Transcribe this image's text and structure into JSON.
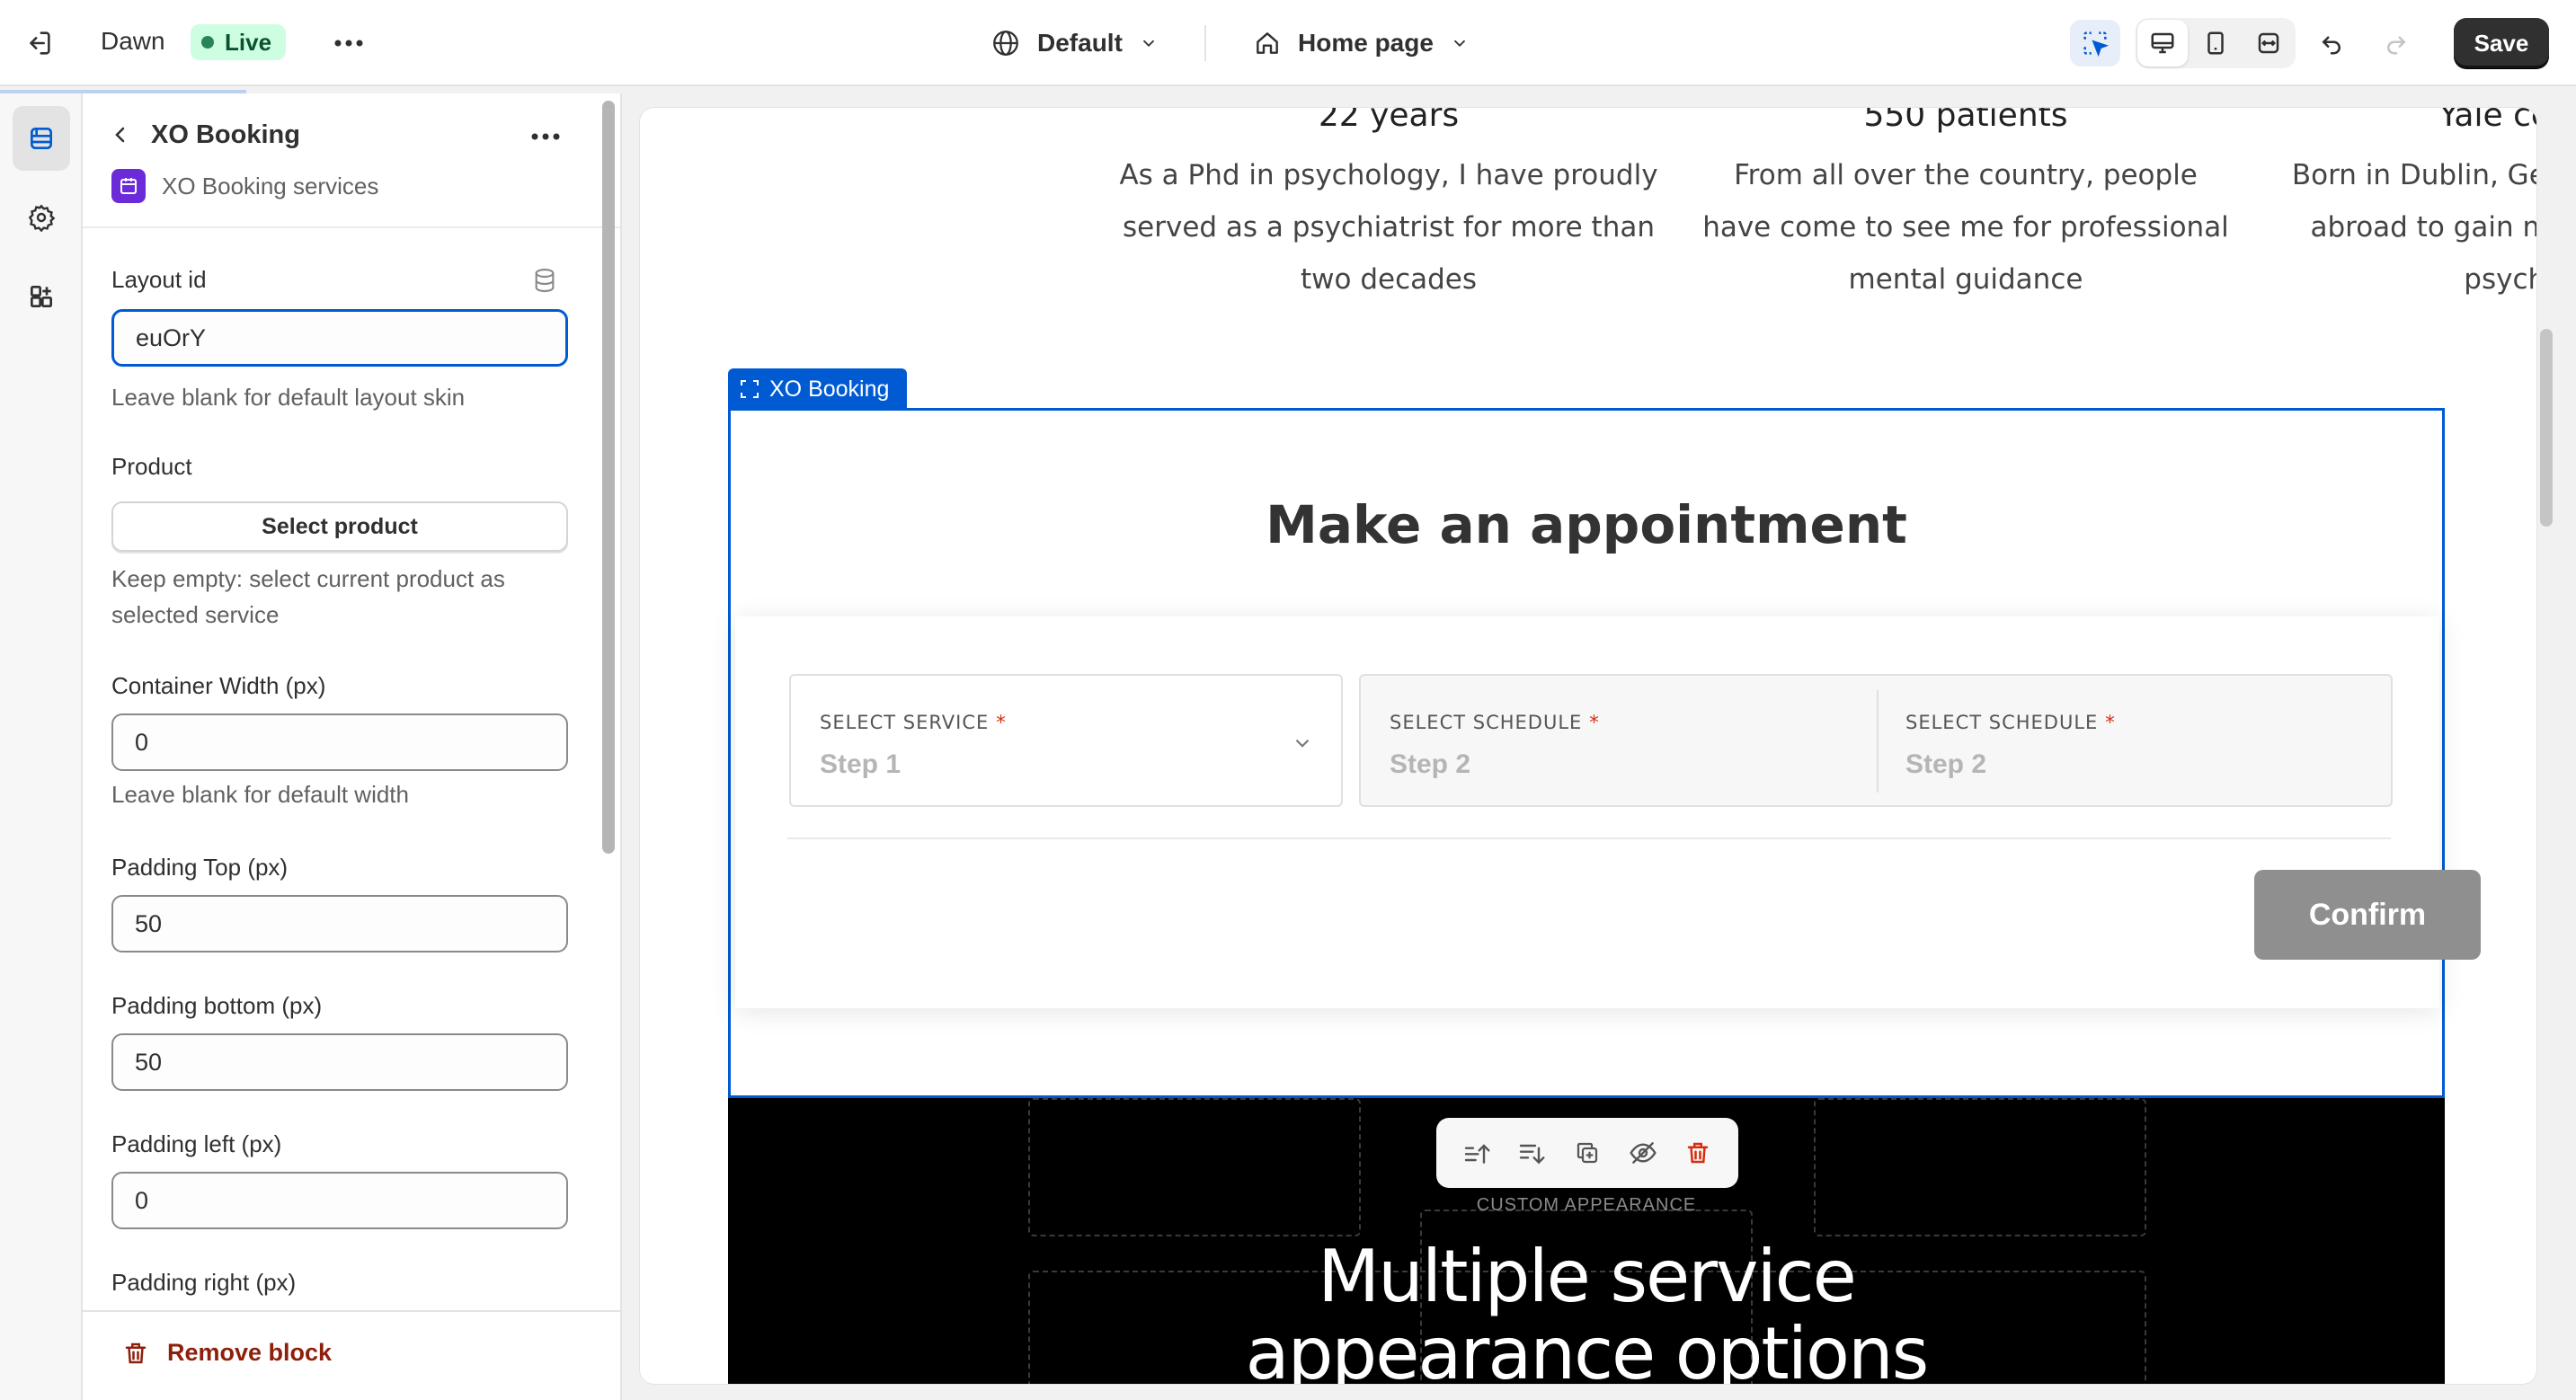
{
  "topbar": {
    "theme_name": "Dawn",
    "status_badge": "Live",
    "template_selector": "Default",
    "page_selector": "Home page",
    "save_label": "Save"
  },
  "sidebar": {
    "block_title": "XO Booking",
    "app_name": "XO Booking services",
    "layout_id": {
      "label": "Layout id",
      "value": "euOrY",
      "help": "Leave blank for default layout skin"
    },
    "product": {
      "label": "Product",
      "button": "Select product",
      "help": "Keep empty: select current product as selected service"
    },
    "container_width": {
      "label": "Container Width (px)",
      "value": "0",
      "help": "Leave blank for default width"
    },
    "padding_top": {
      "label": "Padding Top (px)",
      "value": "50"
    },
    "padding_bottom": {
      "label": "Padding bottom (px)",
      "value": "50"
    },
    "padding_left": {
      "label": "Padding left (px)",
      "value": "0"
    },
    "padding_right": {
      "label": "Padding right (px)"
    },
    "remove_block": "Remove block"
  },
  "preview": {
    "columns": [
      {
        "heading": "22 years",
        "text": "As a Phd in psychology, I have proudly served as a psychiatrist for more than two decades"
      },
      {
        "heading": "550 patients",
        "text": "From all over the country, people have come to see me for professional mental guidance"
      },
      {
        "heading": "Yale certified",
        "text": "Born in Dublin, Germany, I travelled abroad to gain my certification in psychology"
      }
    ],
    "selected_block_tag": "XO Booking",
    "booking": {
      "title": "Make an appointment",
      "steps": [
        {
          "label": "SELECT SERVICE",
          "value": "Step 1"
        },
        {
          "label": "SELECT SCHEDULE",
          "value": "Step 2"
        },
        {
          "label": "SELECT SCHEDULE",
          "value": "Step 2"
        }
      ],
      "required_mark": "*",
      "confirm": "Confirm"
    },
    "next_section": {
      "eyebrow": "CUSTOM APPEARANCE",
      "title_line1": "Multiple service",
      "title_line2": "appearance options"
    }
  },
  "colors": {
    "accent": "#005bd3",
    "live_badge_bg": "#cdfee1",
    "danger": "#8e1f0b",
    "confirm_bg": "#8f8f8f"
  }
}
